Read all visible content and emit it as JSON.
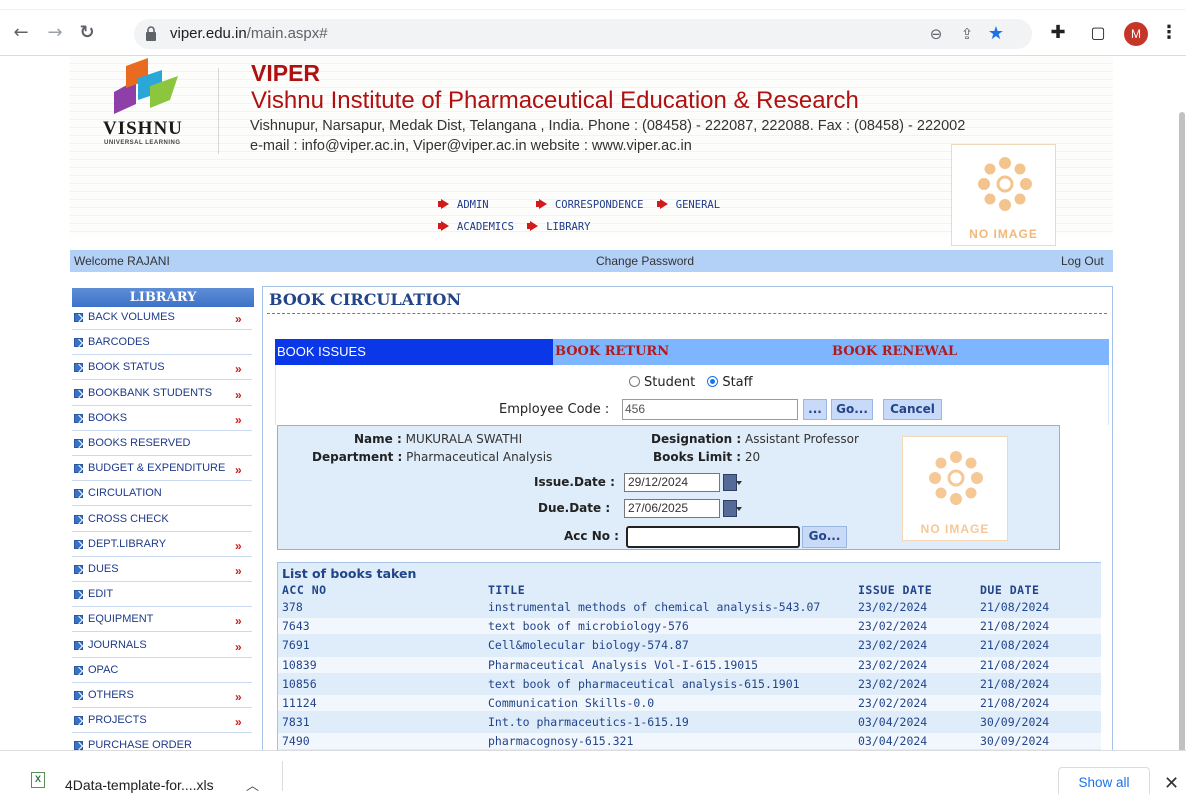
{
  "browser": {
    "url_host": "viper.edu.in",
    "url_path": "/main.aspx#",
    "profile_initial": "M"
  },
  "header": {
    "logo_word": "VISHNU",
    "logo_sub": "UNIVERSAL LEARNING",
    "title": "VIPER",
    "subtitle": "Vishnu Institute of Pharmaceutical Education & Research",
    "address": "Vishnupur, Narsapur, Medak Dist, Telangana , India. Phone : (08458) - 222087, 222088. Fax : (08458) - 222002",
    "contact": "e-mail : info@viper.ac.in, Viper@viper.ac.in      website : www.viper.ac.in",
    "no_image": "NO IMAGE"
  },
  "topmenu": {
    "row1": [
      "ADMIN",
      "CORRESPONDENCE",
      "GENERAL"
    ],
    "row2": [
      "ACADEMICS",
      "LIBRARY"
    ]
  },
  "welcome_bar": {
    "welcome": "Welcome RAJANI",
    "change_password": "Change Password",
    "logout": "Log Out"
  },
  "sidebar": {
    "title": "LIBRARY",
    "items": [
      {
        "label": "BACK VOLUMES",
        "has_submenu": true
      },
      {
        "label": "BARCODES",
        "has_submenu": false
      },
      {
        "label": "BOOK STATUS",
        "has_submenu": true
      },
      {
        "label": "BOOKBANK STUDENTS",
        "has_submenu": true
      },
      {
        "label": "BOOKS",
        "has_submenu": true
      },
      {
        "label": "BOOKS RESERVED",
        "has_submenu": false
      },
      {
        "label": "BUDGET & EXPENDITURE",
        "has_submenu": true
      },
      {
        "label": "CIRCULATION",
        "has_submenu": false
      },
      {
        "label": "CROSS CHECK",
        "has_submenu": false
      },
      {
        "label": "DEPT.LIBRARY",
        "has_submenu": true
      },
      {
        "label": "DUES",
        "has_submenu": true
      },
      {
        "label": "EDIT",
        "has_submenu": false
      },
      {
        "label": "EQUIPMENT",
        "has_submenu": true
      },
      {
        "label": "JOURNALS",
        "has_submenu": true
      },
      {
        "label": "OPAC",
        "has_submenu": false
      },
      {
        "label": "OTHERS",
        "has_submenu": true
      },
      {
        "label": "PROJECTS",
        "has_submenu": true
      },
      {
        "label": "PURCHASE ORDER",
        "has_submenu": false
      }
    ],
    "submenu_glyph": "»"
  },
  "main": {
    "title": "BOOK CIRCULATION",
    "tabs": [
      {
        "label": "BOOK ISSUES",
        "active": true
      },
      {
        "label": "BOOK RETURN",
        "active": false
      },
      {
        "label": "BOOK RENEWAL",
        "active": false
      }
    ],
    "radio": {
      "options": [
        "Student",
        "Staff"
      ],
      "selected": "Staff"
    },
    "employee_code_label": "Employee Code :",
    "employee_code_value": "456",
    "browse_label": "...",
    "go_label": "Go...",
    "cancel_label": "Cancel",
    "details": {
      "name_label": "Name :",
      "name_value": "MUKURALA SWATHI",
      "designation_label": "Designation :",
      "designation_value": "Assistant Professor",
      "department_label": "Department :",
      "department_value": "Pharmaceutical Analysis",
      "books_limit_label": "Books Limit :",
      "books_limit_value": "20",
      "issue_date_label": "Issue.Date :",
      "issue_date_value": "29/12/2024",
      "due_date_label": "Due.Date :",
      "due_date_value": "27/06/2025",
      "acc_no_label": "Acc No :",
      "acc_no_value": "",
      "acc_go_label": "Go...",
      "no_image": "NO IMAGE"
    },
    "books": {
      "title": "List of books taken",
      "headers": [
        "ACC NO",
        "TITLE",
        "ISSUE DATE",
        "DUE DATE"
      ],
      "rows": [
        [
          "378",
          "instrumental methods of chemical analysis-543.07",
          "23/02/2024",
          "21/08/2024"
        ],
        [
          "7643",
          "text book of microbiology-576",
          "23/02/2024",
          "21/08/2024"
        ],
        [
          "7691",
          "Cell&molecular biology-574.87",
          "23/02/2024",
          "21/08/2024"
        ],
        [
          "10839",
          "Pharmaceutical Analysis Vol-I-615.19015",
          "23/02/2024",
          "21/08/2024"
        ],
        [
          "10856",
          "text book of pharmaceutical analysis-615.1901",
          "23/02/2024",
          "21/08/2024"
        ],
        [
          "11124",
          "Communication Skills-0.0",
          "23/02/2024",
          "21/08/2024"
        ],
        [
          "7831",
          "Int.to pharmaceutics-1-615.19",
          "03/04/2024",
          "30/09/2024"
        ],
        [
          "7490",
          "pharmacognosy-615.321",
          "03/04/2024",
          "30/09/2024"
        ]
      ]
    }
  },
  "download_bar": {
    "file_name": "4Data-template-for....xls",
    "show_all": "Show all"
  },
  "colors": {
    "brand_red": "#b01010",
    "link_blue": "#1f3a8a",
    "tab_active": "#0a37e8",
    "tab_bar": "#7db5ff",
    "welcome_bar": "#b3d1f7"
  }
}
